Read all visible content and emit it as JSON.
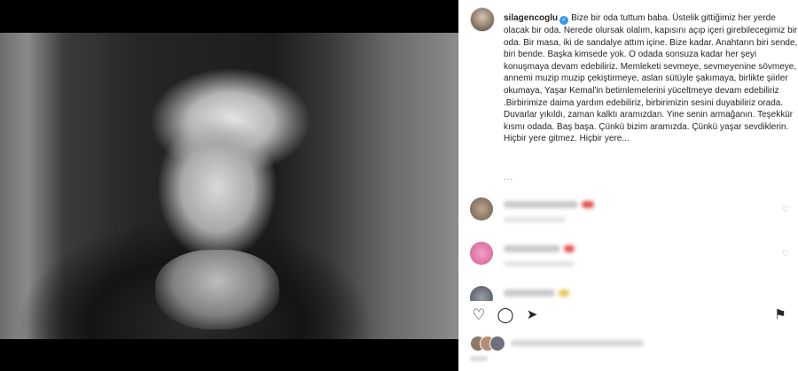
{
  "post": {
    "username": "silagencoglu",
    "verified_glyph": "✓",
    "caption": "Bize bir oda tuttum baba. Üstelik gittiğimiz her yerde olacak bir oda. Nerede olursak olalım, kapısını açıp içeri girebilecegimiz bir oda. Bir masa, iki de sandalye attım içine. Bize kadar. Anahtarın biri sende, biri bende. Başka kimsede yok. O odada sonsuza kadar her şeyi konuşmaya devam edebiliriz. Memleketi sevmeye, sevmeyenine sövmeye, annemi muzip muzip çekiştirmeye, aslan sütüyle şakımaya, birlikte şiirler okumaya, Yaşar Kemal'in betimlemelerini yüceltmeye devam edebiliriz .Birbirimize daima yardım edebiliriz, birbirimizin sesini duyabiliriz orada. Duvarlar yıkıldı, zaman kalktı aramızdan. Yine senin armağanın. Teşekkür kısmı odada. Baş başa. Çünkü bizim aramızda. Çünkü yaşar sevdiklerin. Hiçbir yere gitmez. Hiçbir yere...",
    "more_dots": "..."
  },
  "icons": {
    "verified": "verified-badge-icon",
    "like": "heart-icon",
    "comment": "comment-icon",
    "share": "send-icon",
    "save": "bookmark-icon"
  },
  "glyphs": {
    "like": "♡",
    "comment": "◯",
    "share": "➤",
    "save": "⚑",
    "small_heart": "♡"
  },
  "colors": {
    "verified": "#3897f0",
    "text": "#262626",
    "muted": "#8e8e8e"
  }
}
